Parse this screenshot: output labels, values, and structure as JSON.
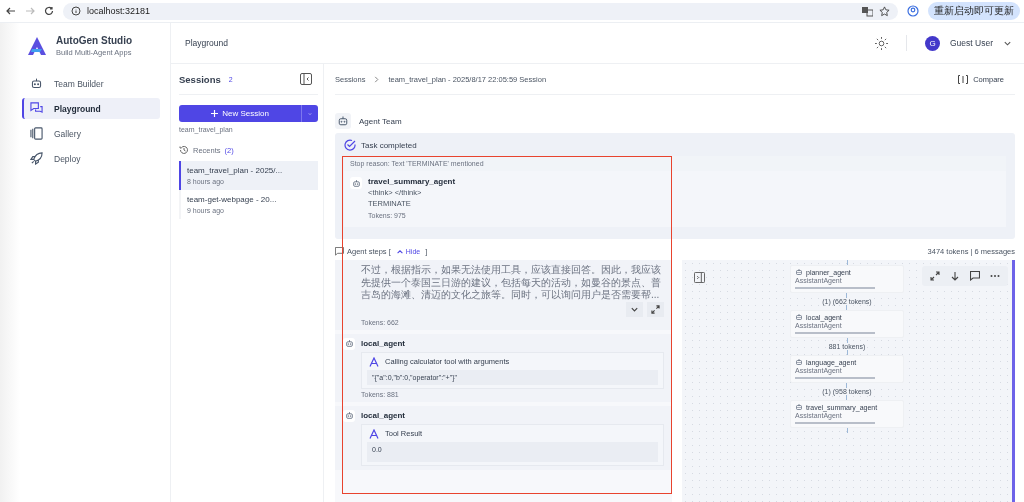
{
  "browser": {
    "url": "localhost:32181",
    "update_button": "重新启动即可更新"
  },
  "brand": {
    "title": "AutoGen Studio",
    "subtitle": "Build Multi-Agent Apps"
  },
  "nav": [
    {
      "label": "Team Builder",
      "selected": false
    },
    {
      "label": "Playground",
      "selected": true
    },
    {
      "label": "Gallery",
      "selected": false
    },
    {
      "label": "Deploy",
      "selected": false
    }
  ],
  "header": {
    "title": "Playground",
    "user_initial": "G",
    "user_name": "Guest User"
  },
  "sessions": {
    "title": "Sessions",
    "count": "2",
    "new_button": "New Session",
    "team_label": "team_travel_plan",
    "recents_label": "Recents",
    "recents_count": "(2)",
    "items": [
      {
        "title": "team_travel_plan - 2025/...",
        "time": "8 hours ago",
        "selected": true
      },
      {
        "title": "team-get-webpage - 20...",
        "time": "9 hours ago",
        "selected": false
      }
    ]
  },
  "breadcrumb": {
    "root": "Sessions",
    "current": "team_travel_plan - 2025/8/17 22:05:59 Session",
    "compare": "Compare"
  },
  "team": {
    "title": "Agent Team",
    "status": "Task completed",
    "stop_reason": "Stop reason: Text 'TERMINATE' mentioned",
    "final": {
      "agent": "travel_summary_agent",
      "lines": [
        "<think> </think>",
        "TERMINATE"
      ],
      "tokens": "Tokens: 975"
    }
  },
  "steps": {
    "prefix": "Agent steps [",
    "toggle": "Hide",
    "suffix": "]",
    "summary": "3474 tokens | 6 messages",
    "items": [
      {
        "kind": "text",
        "text": "不过，根据指示，如果无法使用工具，应该直接回答。因此，我应该先提供一个泰国三日游的建议，包括每天的活动，如曼谷的景点、普吉岛的海滩、清迈的文化之旅等。同时，可以询问用户是否需要帮...",
        "tokens": "Tokens: 662"
      },
      {
        "kind": "tool_call",
        "agent": "local_agent",
        "title": "Calling calculator tool with arguments",
        "body": "\"{\"a\":0,\"b\":0,\"operator\":\"+\"}\"",
        "tokens": "Tokens: 881"
      },
      {
        "kind": "tool_result",
        "agent": "local_agent",
        "title": "Tool Result",
        "body": "0.0"
      }
    ]
  },
  "flow": {
    "nodes": [
      {
        "name": "planner_agent",
        "type": "AssistantAgent"
      },
      {
        "name": "local_agent",
        "type": "AssistantAgent"
      },
      {
        "name": "language_agent",
        "type": "AssistantAgent"
      },
      {
        "name": "travel_summary_agent",
        "type": "AssistantAgent"
      }
    ],
    "edges": [
      "(1) (662 tokens)",
      "881 tokens)",
      "(1) (958 tokens)"
    ]
  }
}
